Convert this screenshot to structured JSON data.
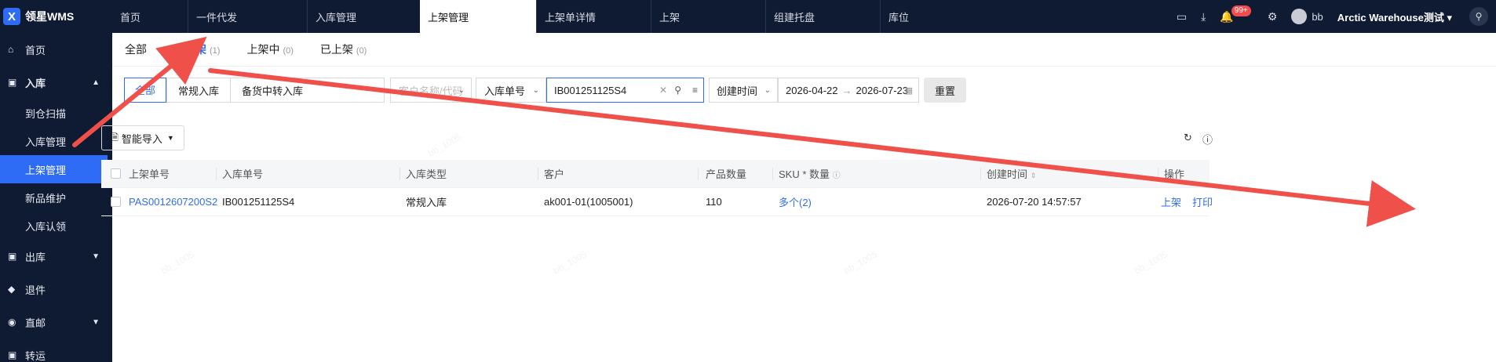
{
  "app": {
    "logo_mark": "X",
    "name": "领星WMS"
  },
  "top_tabs": [
    {
      "label": "首页",
      "width": 96,
      "active": false
    },
    {
      "label": "一件代发",
      "width": 152,
      "active": false
    },
    {
      "label": "入库管理",
      "width": 144,
      "active": false
    },
    {
      "label": "上架管理",
      "width": 148,
      "active": true
    },
    {
      "label": "上架单详情",
      "width": 146,
      "active": false
    },
    {
      "label": "上架",
      "width": 146,
      "active": false
    },
    {
      "label": "组建托盘",
      "width": 146,
      "active": false
    },
    {
      "label": "库位",
      "width": 146,
      "active": false
    }
  ],
  "top_right": {
    "notification_count": "99+",
    "username": "bb",
    "warehouse": "Arctic Warehouse测试"
  },
  "sidebar": {
    "home": "首页",
    "inbound": "入库",
    "inbound_items": [
      "到仓扫描",
      "入库管理",
      "上架管理",
      "新品维护",
      "入库认领"
    ],
    "outbound": "出库",
    "returns": "退件",
    "direct": "直邮",
    "transfer": "转运"
  },
  "status_tabs": [
    {
      "label": "全部",
      "count": ""
    },
    {
      "label": "待上架",
      "count": "(1)"
    },
    {
      "label": "上架中",
      "count": "(0)"
    },
    {
      "label": "已上架",
      "count": "(0)"
    }
  ],
  "filters": {
    "type_buttons": [
      "全部",
      "常规入库",
      "备货中转入库"
    ],
    "customer_placeholder": "客户名称/代码",
    "search_field": "入库单号",
    "search_value": "IB001251125S4",
    "time_field": "创建时间",
    "date_from": "2026-04-22",
    "date_to": "2026-07-23",
    "reset": "重置"
  },
  "toolbar": {
    "import": "智能导入"
  },
  "table": {
    "headers": {
      "putaway_no": "上架单号",
      "inbound_no": "入库单号",
      "inbound_type": "入库类型",
      "customer": "客户",
      "qty": "产品数量",
      "sku_qty": "SKU * 数量",
      "created": "创建时间",
      "actions": "操作"
    },
    "rows": [
      {
        "putaway_no": "PAS0012607200S2",
        "inbound_no": "IB001251125S4",
        "inbound_type": "常规入库",
        "customer": "ak001-01(1005001)",
        "qty": "110",
        "sku_qty": "多个(2)",
        "created": "2026-07-20 14:57:57",
        "action_putaway": "上架",
        "action_print": "打印"
      }
    ]
  },
  "watermark": "bb_1005",
  "colors": {
    "accent": "#2f6cf6",
    "nav_bg": "#0f1a33",
    "arrow": "#f0504a"
  }
}
